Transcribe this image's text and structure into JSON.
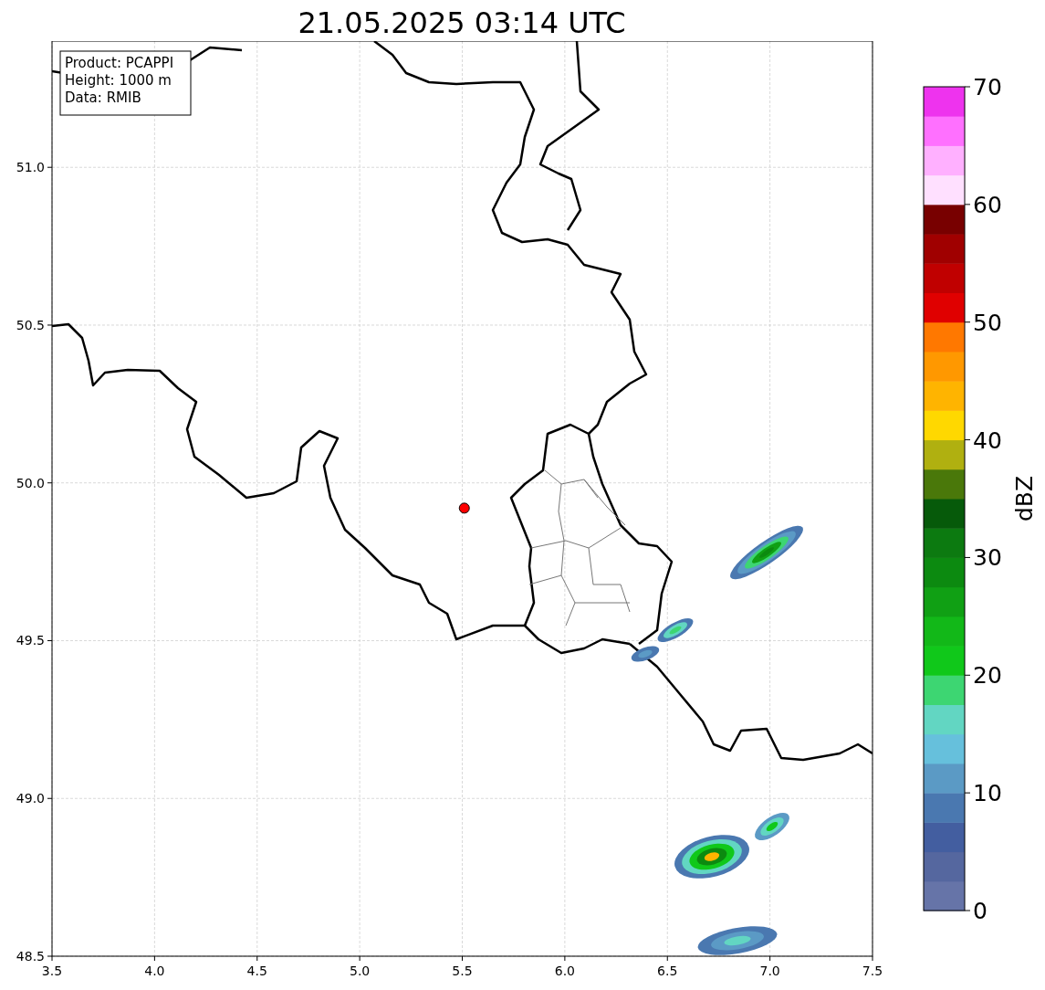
{
  "title": "21.05.2025 03:14 UTC",
  "map": {
    "info_box": [
      "Product: PCAPPI",
      "Height: 1000 m",
      "Data: RMIB"
    ],
    "chart_data": {
      "type": "scatter",
      "xlim": [
        3.5,
        7.5
      ],
      "ylim": [
        48.5,
        51.4
      ],
      "xticks": [
        {
          "value": 3.5,
          "label": "3.5"
        },
        {
          "value": 4,
          "label": "4.0"
        },
        {
          "value": 4.5,
          "label": "4.5"
        },
        {
          "value": 5,
          "label": "5.0"
        },
        {
          "value": 5.5,
          "label": "5.5"
        },
        {
          "value": 6,
          "label": "6.0"
        },
        {
          "value": 6.5,
          "label": "6.5"
        },
        {
          "value": 7,
          "label": "7.0"
        },
        {
          "value": 7.5,
          "label": "7.5"
        }
      ],
      "yticks": [
        {
          "value": 48.5,
          "label": "48.5"
        },
        {
          "value": 49,
          "label": "49.0"
        },
        {
          "value": 49.5,
          "label": "49.5"
        },
        {
          "value": 50,
          "label": "50.0"
        },
        {
          "value": 50.5,
          "label": "50.5"
        },
        {
          "value": 51,
          "label": "51.0"
        }
      ],
      "grid": true,
      "series": [
        {
          "color": "#ff0000",
          "x": [
            5.51
          ],
          "values": [
            49.92
          ]
        }
      ]
    }
  },
  "colorbar": {
    "label": "dBZ",
    "ticks": [
      "70",
      "60",
      "50",
      "40",
      "30",
      "20",
      "10",
      "0"
    ],
    "segments": [
      {
        "color": "#6674a8"
      },
      {
        "color": "#55679f"
      },
      {
        "color": "#435ea0"
      },
      {
        "color": "#4a78b0"
      },
      {
        "color": "#5b9ac5"
      },
      {
        "color": "#66c0dc"
      },
      {
        "color": "#62d6c2"
      },
      {
        "color": "#3dd672"
      },
      {
        "color": "#10c81a"
      },
      {
        "color": "#12b818"
      },
      {
        "color": "#10a014"
      },
      {
        "color": "#0c8a10"
      },
      {
        "color": "#0c7a10"
      },
      {
        "color": "#065a0a"
      },
      {
        "color": "#4a780a"
      },
      {
        "color": "#b0b010"
      },
      {
        "color": "#ffd800"
      },
      {
        "color": "#ffb400"
      },
      {
        "color": "#ff9800"
      },
      {
        "color": "#ff7800"
      },
      {
        "color": "#e00000"
      },
      {
        "color": "#c00000"
      },
      {
        "color": "#a00000"
      },
      {
        "color": "#780000"
      },
      {
        "color": "#ffe0ff"
      },
      {
        "color": "#ffb0ff"
      },
      {
        "color": "#ff70ff"
      },
      {
        "color": "#ee33ee"
      }
    ]
  }
}
